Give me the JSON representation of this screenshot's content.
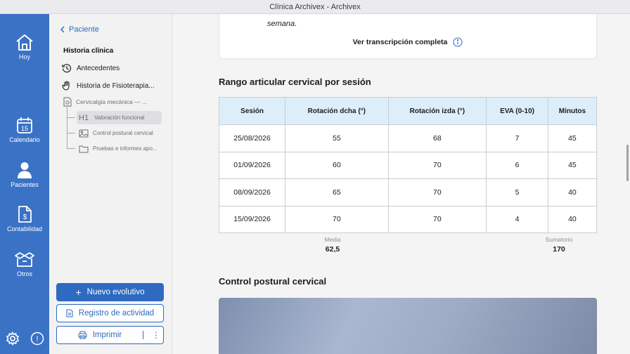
{
  "window": {
    "title": "Clínica Archivex - Archivex"
  },
  "rail": {
    "items": [
      {
        "label": "Hoy",
        "icon": "home-icon"
      },
      {
        "label": "Calendario",
        "icon": "calendar-icon",
        "badge": "15"
      },
      {
        "label": "Pacientes",
        "icon": "person-icon"
      },
      {
        "label": "Contabilidad",
        "icon": "invoice-icon"
      },
      {
        "label": "Otros",
        "icon": "box-icon"
      }
    ],
    "settings_icon": "gear-icon",
    "alert_icon": "info-alert-icon",
    "alert_glyph": "!"
  },
  "sidebar": {
    "back_label": "Paciente",
    "heading": "Historia clínica",
    "items": [
      {
        "label": "Antecedentes",
        "icon": "history-icon"
      },
      {
        "label": "Historia de Fisioterapia...",
        "icon": "hand-icon"
      }
    ],
    "record": {
      "label": "Cervicalgia mecánica — ...",
      "icon": "document-medical-icon"
    },
    "tree": [
      {
        "label": "Valoración funcional",
        "icon": "heading-icon",
        "icon_text": "H1",
        "active": true
      },
      {
        "label": "Control postural cervical",
        "icon": "image-icon",
        "active": false
      },
      {
        "label": "Pruebas e informes apo...",
        "icon": "folder-icon",
        "active": false
      }
    ],
    "buttons": {
      "new": "Nuevo evolutivo",
      "activity": "Registro de actividad",
      "print": "Imprimir",
      "more": "⋮"
    }
  },
  "main": {
    "top_card": {
      "italic_text": "semana.",
      "transcript_label": "Ver transcripción completa"
    },
    "table_title": "Rango articular cervical por sesión",
    "table": {
      "headers": [
        "Sesión",
        "Rotación dcha (°)",
        "Rotación izda (°)",
        "EVA (0-10)",
        "Minutos"
      ],
      "rows": [
        [
          "25/08/2026",
          "55",
          "68",
          "7",
          "45"
        ],
        [
          "01/09/2026",
          "60",
          "70",
          "6",
          "45"
        ],
        [
          "08/09/2026",
          "65",
          "70",
          "5",
          "40"
        ],
        [
          "15/09/2026",
          "70",
          "70",
          "4",
          "40"
        ]
      ]
    },
    "summary": {
      "mean_label": "Media",
      "mean_value": "62,5",
      "sum_label": "Sumatorio",
      "sum_value": "170"
    },
    "photo_title": "Control postural cervical"
  }
}
